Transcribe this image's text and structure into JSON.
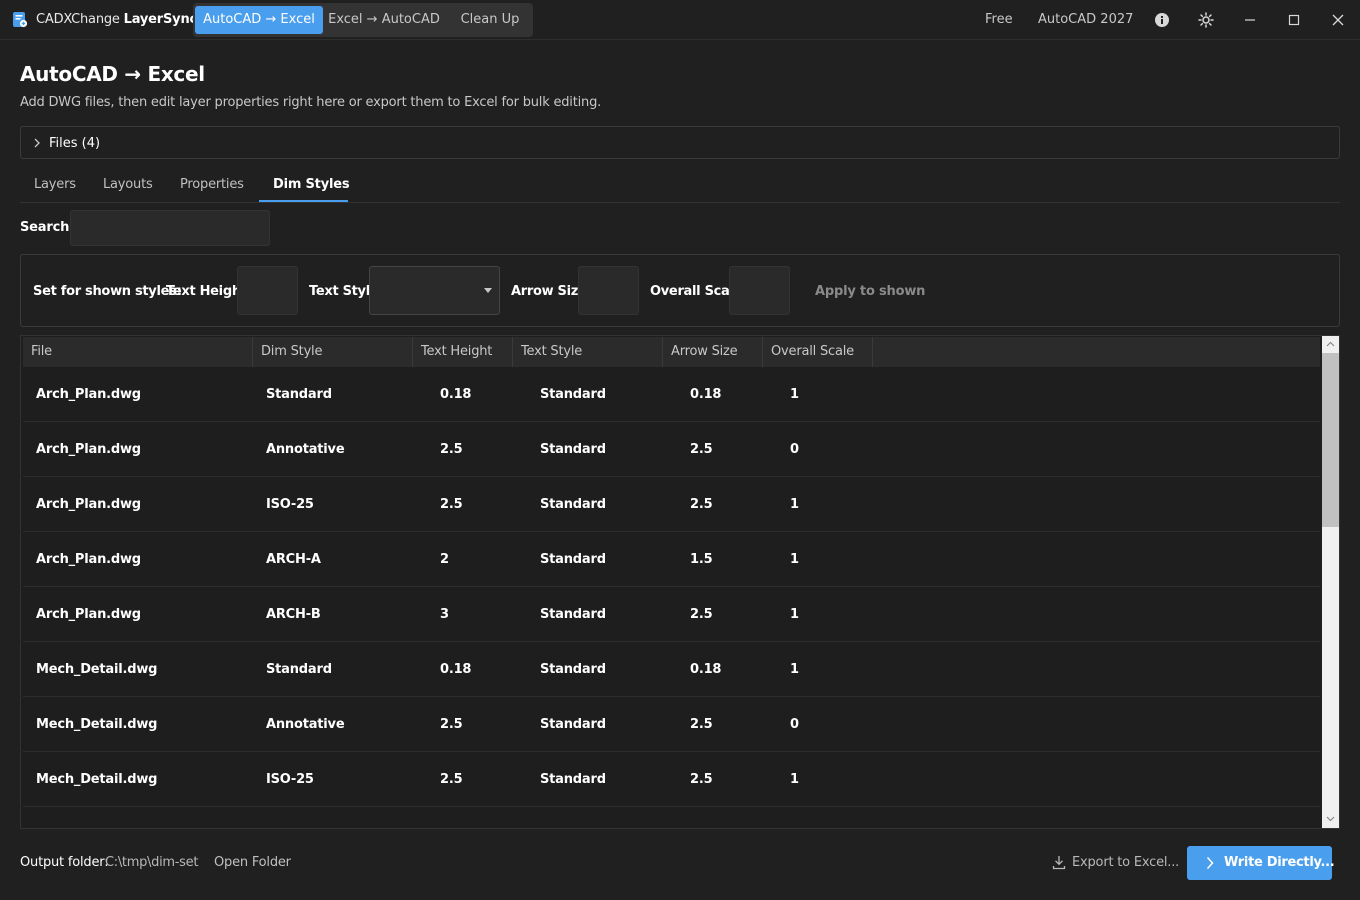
{
  "app": {
    "name_light": "CADXChange",
    "name_bold": "LayerSync"
  },
  "modes": [
    {
      "label": "AutoCAD → Excel"
    },
    {
      "label": "Excel → AutoCAD"
    },
    {
      "label": "Clean Up"
    }
  ],
  "titlebar": {
    "plan": "Free",
    "version": "AutoCAD 2027"
  },
  "page": {
    "title": "AutoCAD → Excel",
    "subtitle": "Add DWG files, then edit layer properties right here or export them to Excel for bulk editing."
  },
  "files_panel": {
    "label": "Files (4)"
  },
  "tabs": [
    {
      "label": "Layers"
    },
    {
      "label": "Layouts"
    },
    {
      "label": "Properties"
    },
    {
      "label": "Dim Styles"
    }
  ],
  "search": {
    "label": "Search:",
    "value": ""
  },
  "bulk": {
    "intro": "Set for shown styles:",
    "text_height_label": "Text Height",
    "text_style_label": "Text Style",
    "arrow_size_label": "Arrow Size",
    "overall_scale_label": "Overall Scale",
    "apply_label": "Apply to shown"
  },
  "table": {
    "columns": [
      "File",
      "Dim Style",
      "Text Height",
      "Text Style",
      "Arrow Size",
      "Overall Scale"
    ],
    "rows": [
      [
        "Arch_Plan.dwg",
        "Standard",
        "0.18",
        "Standard",
        "0.18",
        "1"
      ],
      [
        "Arch_Plan.dwg",
        "Annotative",
        "2.5",
        "Standard",
        "2.5",
        "0"
      ],
      [
        "Arch_Plan.dwg",
        "ISO-25",
        "2.5",
        "Standard",
        "2.5",
        "1"
      ],
      [
        "Arch_Plan.dwg",
        "ARCH-A",
        "2",
        "Standard",
        "1.5",
        "1"
      ],
      [
        "Arch_Plan.dwg",
        "ARCH-B",
        "3",
        "Standard",
        "2.5",
        "1"
      ],
      [
        "Mech_Detail.dwg",
        "Standard",
        "0.18",
        "Standard",
        "0.18",
        "1"
      ],
      [
        "Mech_Detail.dwg",
        "Annotative",
        "2.5",
        "Standard",
        "2.5",
        "0"
      ],
      [
        "Mech_Detail.dwg",
        "ISO-25",
        "2.5",
        "Standard",
        "2.5",
        "1"
      ]
    ]
  },
  "footer": {
    "output_label": "Output folder:",
    "output_path": "C:\\tmp\\dim-set",
    "open_folder": "Open Folder",
    "export_label": "Export to Excel...",
    "write_label": "Write Directly..."
  },
  "colors": {
    "accent": "#4a9eee",
    "background": "#202020"
  },
  "icons": {
    "logo": "file-swap-icon",
    "info": "info-icon",
    "theme": "sun-icon",
    "minimize": "minimize-icon",
    "maximize": "maximize-icon",
    "close": "close-icon",
    "expand": "chevron-right-icon",
    "export": "download-icon",
    "write": "chevron-right-icon"
  }
}
